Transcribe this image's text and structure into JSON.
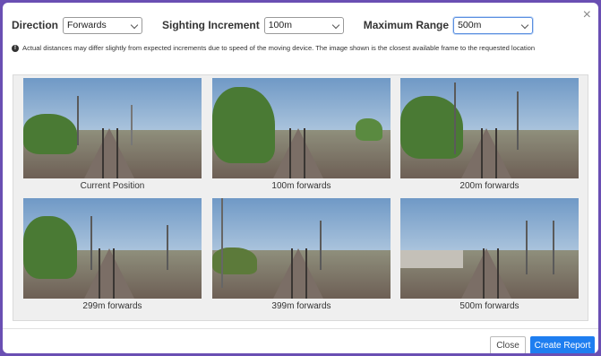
{
  "controls": {
    "direction_label": "Direction",
    "direction_value": "Forwards",
    "increment_label": "Sighting Increment",
    "increment_value": "100m",
    "range_label": "Maximum Range",
    "range_value": "500m"
  },
  "info_text": "Actual distances may differ slightly from expected increments due to speed of the moving device. The image shown is the closest available frame to the requested location",
  "close_symbol": "×",
  "thumbnails": [
    {
      "caption": "Current Position"
    },
    {
      "caption": "100m forwards"
    },
    {
      "caption": "200m forwards"
    },
    {
      "caption": "299m forwards"
    },
    {
      "caption": "399m forwards"
    },
    {
      "caption": "500m forwards"
    }
  ],
  "footer": {
    "close_label": "Close",
    "report_label": "Create Report"
  },
  "colors": {
    "accent": "#1e7ef0",
    "backdrop": "#6a4fb3"
  }
}
